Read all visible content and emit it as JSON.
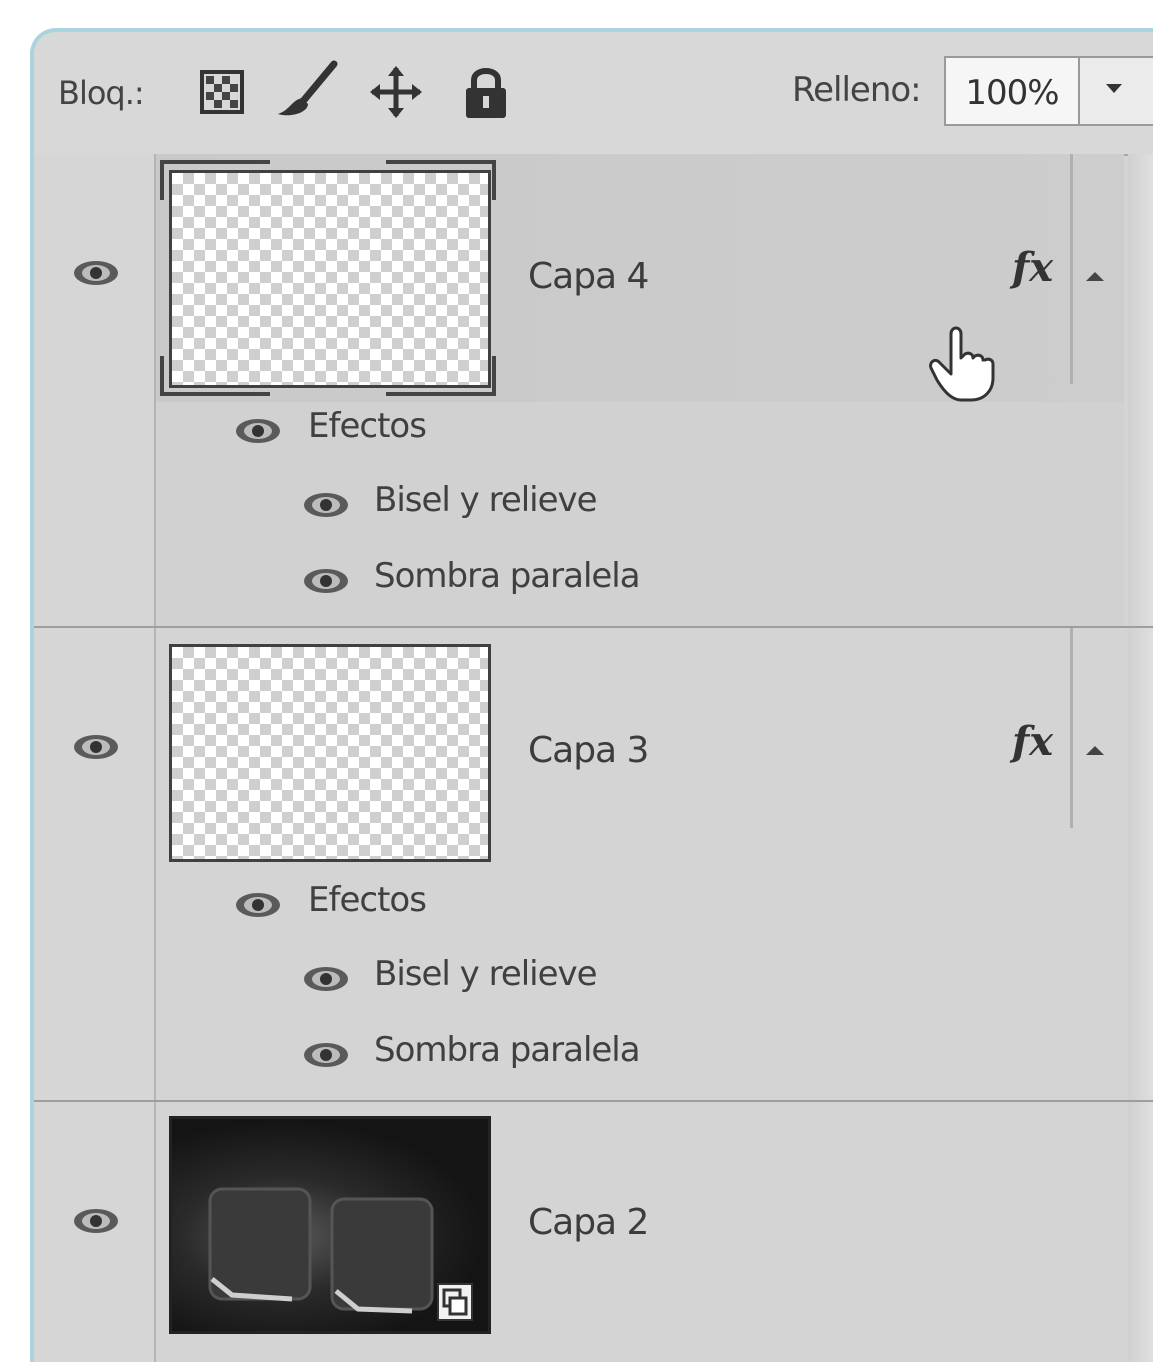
{
  "toolbar": {
    "lock_label": "Bloq.:",
    "fill_label": "Relleno:",
    "fill_value": "100%",
    "lock_icons": [
      "lock-transparent-pixels-icon",
      "lock-image-pixels-icon",
      "lock-position-icon",
      "lock-all-icon"
    ]
  },
  "layers": [
    {
      "name": "Capa 4",
      "has_fx": true,
      "fx_label": "fx",
      "effects_label": "Efectos",
      "effects": [
        "Bisel y relieve",
        "Sombra paralela"
      ]
    },
    {
      "name": "Capa 3",
      "has_fx": true,
      "fx_label": "fx",
      "effects_label": "Efectos",
      "effects": [
        "Bisel y relieve",
        "Sombra paralela"
      ]
    },
    {
      "name": "Capa 2",
      "has_fx": false,
      "thumbnail": "dark-image-thumbnail"
    }
  ],
  "colors": {
    "panel_bg": "#d4d4d4",
    "panel_border": "#a9d3de",
    "text": "#3c3c3c"
  }
}
